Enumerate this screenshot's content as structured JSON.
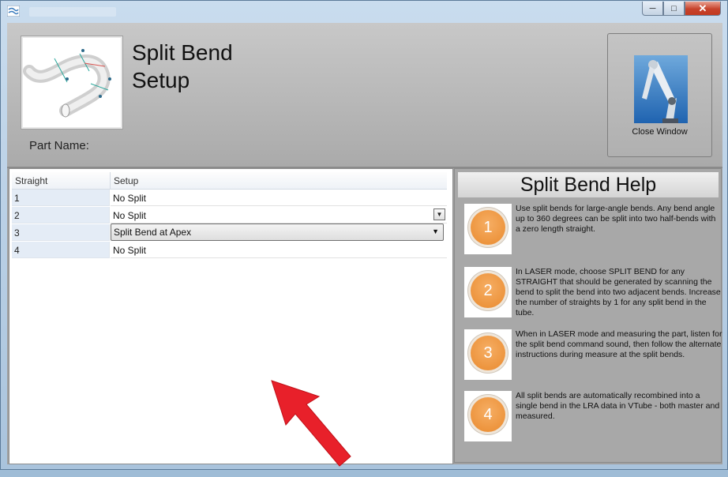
{
  "window": {
    "app_icon": "app-icon",
    "minimize": "─",
    "maximize": "□",
    "close": "✕"
  },
  "header": {
    "title_line1": "Split Bend",
    "title_line2": "Setup",
    "part_name_label": "Part Name:",
    "close_button_label": "Close Window"
  },
  "grid": {
    "columns": [
      "Straight",
      "Setup"
    ],
    "rows": [
      {
        "straight": "1",
        "setup": "No Split"
      },
      {
        "straight": "2",
        "setup": "No Split"
      },
      {
        "straight": "3",
        "setup": "Split Bend at Apex"
      },
      {
        "straight": "4",
        "setup": "No Split"
      }
    ]
  },
  "help": {
    "title": "Split Bend Help",
    "steps": [
      {
        "number": "1",
        "text": "Use split bends for large-angle bends.  Any bend angle up to 360 degrees can be split into two half-bends with a zero length straight."
      },
      {
        "number": "2",
        "text": "In LASER mode, choose SPLIT BEND for any STRAIGHT that should be generated by scanning the bend to split the bend into two adjacent bends. Increase the number of straights by 1 for any split bend in the tube."
      },
      {
        "number": "3",
        "text": "When in LASER mode and measuring the part, listen for the split bend command sound, then follow the alternate instructions during measure at the split bends."
      },
      {
        "number": "4",
        "text": "All split bends are automatically recombined into a single bend in the LRA data in VTube - both master and measured."
      }
    ]
  },
  "colors": {
    "badge": "#e98a2e",
    "arrow": "#e8202a",
    "row_header": "#e4ecf6"
  }
}
